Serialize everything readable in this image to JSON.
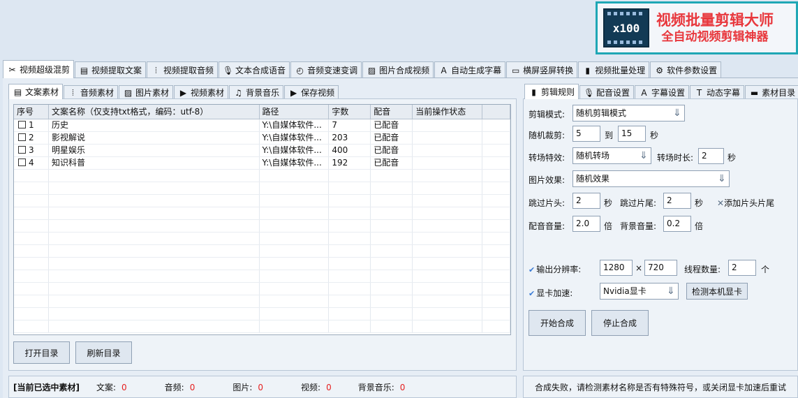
{
  "logo": {
    "badge": "x100",
    "title": "视频批量剪辑大师",
    "subtitle": "全自动视频剪辑神器"
  },
  "colors": {
    "accent": "#1fa7b5",
    "logo_red": "#e8383d",
    "status_red": "#e52020"
  },
  "main_tabs": [
    {
      "label": "视频超级混剪",
      "icon": "scissors-icon",
      "glyph": "✂"
    },
    {
      "label": "视频提取文案",
      "icon": "document-icon",
      "glyph": "▤"
    },
    {
      "label": "视频提取音频",
      "icon": "waveform-icon",
      "glyph": "⦙"
    },
    {
      "label": "文本合成语音",
      "icon": "microphone-icon",
      "glyph": "🎙"
    },
    {
      "label": "音频变速变调",
      "icon": "gauge-icon",
      "glyph": "◴"
    },
    {
      "label": "图片合成视频",
      "icon": "image-icon",
      "glyph": "▨"
    },
    {
      "label": "自动生成字幕",
      "icon": "font-icon",
      "glyph": "A"
    },
    {
      "label": "横屏竖屏转换",
      "icon": "rotate-screen-icon",
      "glyph": "▭"
    },
    {
      "label": "视频批量处理",
      "icon": "film-icon",
      "glyph": "▮"
    },
    {
      "label": "软件参数设置",
      "icon": "gear-icon",
      "glyph": "⚙"
    }
  ],
  "left_tabs": [
    {
      "label": "文案素材",
      "icon": "document-icon",
      "glyph": "▤"
    },
    {
      "label": "音频素材",
      "icon": "waveform-icon",
      "glyph": "⦙"
    },
    {
      "label": "图片素材",
      "icon": "image-icon",
      "glyph": "▨"
    },
    {
      "label": "视频素材",
      "icon": "play-icon",
      "glyph": "▶"
    },
    {
      "label": "背景音乐",
      "icon": "music-icon",
      "glyph": "♫"
    },
    {
      "label": "保存视频",
      "icon": "save-icon",
      "glyph": "▶"
    }
  ],
  "table": {
    "columns": [
      "序号",
      "文案名称（仅支持txt格式，编码：utf-8）",
      "路径",
      "字数",
      "配音",
      "当前操作状态"
    ],
    "rows": [
      {
        "index": "1",
        "name": "历史",
        "path": "Y:\\自媒体软件...",
        "count": "7",
        "dub": "已配音",
        "status": ""
      },
      {
        "index": "2",
        "name": "影视解说",
        "path": "Y:\\自媒体软件...",
        "count": "203",
        "dub": "已配音",
        "status": ""
      },
      {
        "index": "3",
        "name": "明星娱乐",
        "path": "Y:\\自媒体软件...",
        "count": "400",
        "dub": "已配音",
        "status": ""
      },
      {
        "index": "4",
        "name": "知识科普",
        "path": "Y:\\自媒体软件...",
        "count": "192",
        "dub": "已配音",
        "status": ""
      }
    ]
  },
  "buttons": {
    "open_dir": "打开目录",
    "refresh_dir": "刷新目录",
    "detect_gpu": "检测本机显卡",
    "start": "开始合成",
    "stop": "停止合成"
  },
  "selected_summary": {
    "title": "[当前已选中素材]",
    "items": [
      {
        "label": "文案:",
        "value": "0"
      },
      {
        "label": "音频:",
        "value": "0"
      },
      {
        "label": "图片:",
        "value": "0"
      },
      {
        "label": "视频:",
        "value": "0"
      },
      {
        "label": "背景音乐:",
        "value": "0"
      }
    ]
  },
  "right_tabs": [
    {
      "label": "剪辑规则",
      "icon": "film-icon",
      "glyph": "▮"
    },
    {
      "label": "配音设置",
      "icon": "microphone-icon",
      "glyph": "🎙"
    },
    {
      "label": "字幕设置",
      "icon": "font-icon",
      "glyph": "A"
    },
    {
      "label": "动态字幕",
      "icon": "text-box-icon",
      "glyph": "T"
    },
    {
      "label": "素材目录",
      "icon": "folder-icon",
      "glyph": "▬"
    }
  ],
  "settings": {
    "edit_mode_label": "剪辑模式:",
    "edit_mode_value": "随机剪辑模式",
    "random_cut_label": "随机裁剪:",
    "random_cut_min": "5",
    "to_label": "到",
    "random_cut_max": "15",
    "sec": "秒",
    "transition_label": "转场特效:",
    "transition_value": "随机转场",
    "transition_duration_label": "转场时长:",
    "transition_duration": "2",
    "image_effect_label": "图片效果:",
    "image_effect_value": "随机效果",
    "skip_head_label": "跳过片头:",
    "skip_head": "2",
    "skip_tail_label": "跳过片尾:",
    "skip_tail": "2",
    "add_head_tail": "添加片头片尾",
    "dub_volume_label": "配音音量:",
    "dub_volume": "2.0",
    "times": "倍",
    "bgm_volume_label": "背景音量:",
    "bgm_volume": "0.2",
    "resolution_label": "输出分辨率:",
    "res_w": "1280",
    "res_x": "×",
    "res_h": "720",
    "threads_label": "线程数量:",
    "threads": "2",
    "unit_count": "个",
    "gpu_label": "显卡加速:",
    "gpu_value": "Nvidia显卡"
  },
  "status_message": "合成失败，请检测素材名称是否有特殊符号，或关闭显卡加速后重试"
}
